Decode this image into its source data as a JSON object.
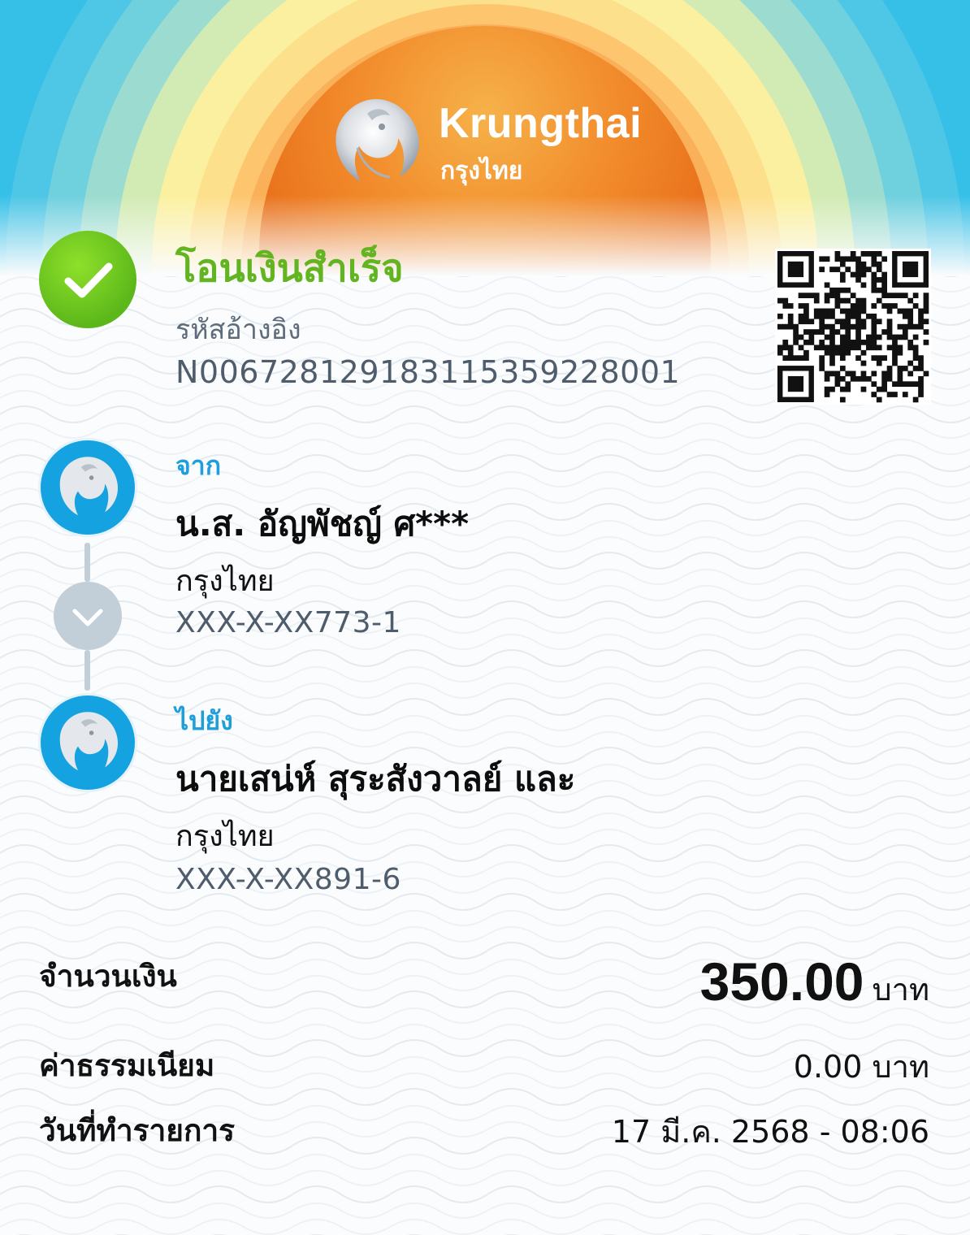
{
  "brand": {
    "name_en": "Krungthai",
    "name_th": "กรุงไทย"
  },
  "status": {
    "title": "โอนเงินสำเร็จ",
    "ref_label": "รหัสอ้างอิง",
    "ref_code": "N006728129183115359228001"
  },
  "from": {
    "label": "จาก",
    "name": "น.ส. อัญพัชญ์ ศ***",
    "bank": "กรุงไทย",
    "account": "XXX-X-XX773-1"
  },
  "to": {
    "label": "ไปยัง",
    "name": "นายเสน่ห์ สุระสังวาลย์ และ",
    "bank": "กรุงไทย",
    "account": "XXX-X-XX891-6"
  },
  "summary": {
    "amount_label": "จำนวนเงิน",
    "amount_value": "350.00",
    "amount_unit": "บาท",
    "fee_label": "ค่าธรรมเนียม",
    "fee_value": "0.00 บาท",
    "date_label": "วันที่ทำรายการ",
    "date_value": "17 มี.ค. 2568 - 08:06"
  },
  "icons": [
    "krungthai-logo-icon",
    "success-check-icon",
    "qr-code-icon",
    "chevron-down-icon"
  ],
  "colors": {
    "success": "#62b520",
    "accent_blue": "#1e9fdc",
    "badge_blue": "#15a2e0",
    "connector": "#c3cfd8",
    "sun_orange": "#f08a2a"
  }
}
